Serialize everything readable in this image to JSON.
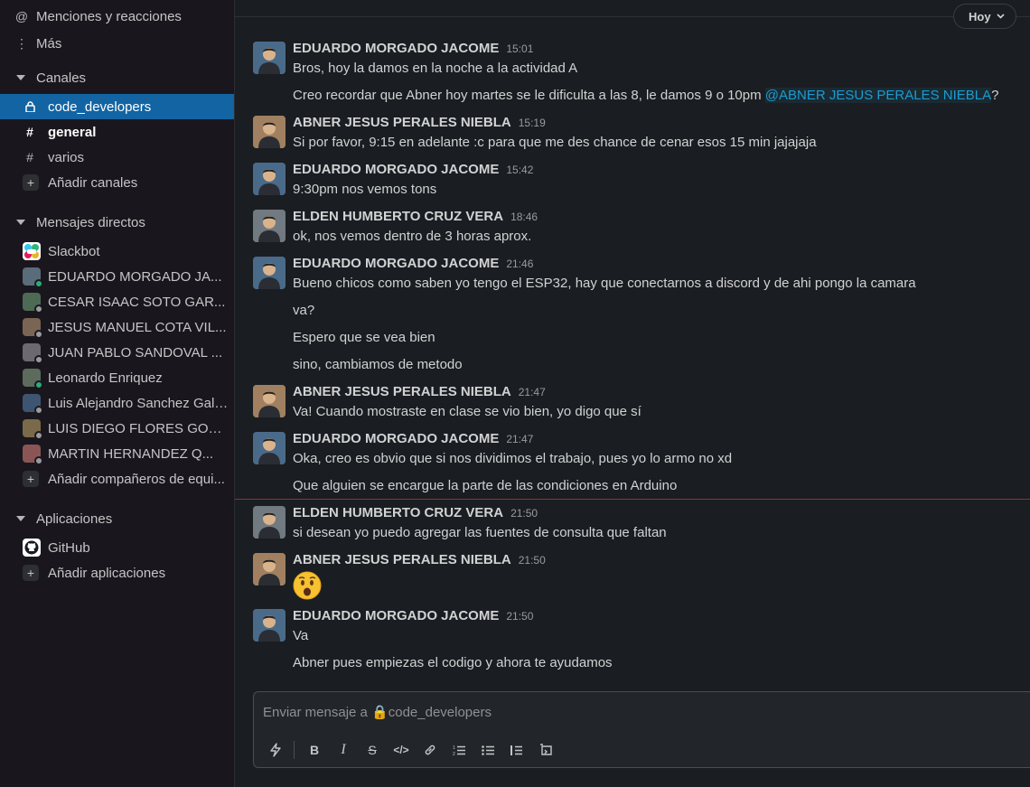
{
  "sidebar": {
    "top_items": [
      {
        "label": "Menciones y reacciones",
        "icon": "at-icon"
      },
      {
        "label": "Más",
        "icon": "more-vertical-icon"
      }
    ],
    "channels_header": "Canales",
    "channels": [
      {
        "label": "code_developers",
        "icon": "lock-icon",
        "active": true
      },
      {
        "label": "general",
        "icon": "hash-icon",
        "bold": true
      },
      {
        "label": "varios",
        "icon": "hash-icon"
      }
    ],
    "add_channels": "Añadir canales",
    "dm_header": "Mensajes directos",
    "dms": [
      {
        "label": "Slackbot",
        "color": "#e8b33a"
      },
      {
        "label": "EDUARDO MORGADO JA...",
        "color": "#5a6b7a",
        "status": "#2bac76"
      },
      {
        "label": "CESAR ISAAC SOTO GAR...",
        "color": "#4d6a55",
        "status": "#9a9b9d"
      },
      {
        "label": "JESUS MANUEL COTA VIL...",
        "color": "#7a6555",
        "status": "#9a9b9d"
      },
      {
        "label": "JUAN PABLO SANDOVAL ...",
        "color": "#6a6a70",
        "status": "#9a9b9d"
      },
      {
        "label": "Leonardo Enriquez",
        "color": "#5c6b5c",
        "status": "#2bac76"
      },
      {
        "label": "Luis Alejandro Sanchez Gall...",
        "color": "#3d5570",
        "status": "#9a9b9d"
      },
      {
        "label": "LUIS DIEGO FLORES GON...",
        "color": "#7a6a4a",
        "status": "#9a9b9d"
      },
      {
        "label": "MARTIN HERNANDEZ Q...",
        "color": "#8a5555",
        "status": "#9a9b9d"
      }
    ],
    "add_teammates": "Añadir compañeros de equi...",
    "apps_header": "Aplicaciones",
    "apps": [
      {
        "label": "GitHub",
        "icon": "github-icon"
      }
    ],
    "add_apps": "Añadir aplicaciones"
  },
  "main": {
    "date_pill": "Hoy",
    "messages": [
      {
        "name": "EDUARDO MORGADO JACOME",
        "time": "15:01",
        "avatar_color": "#4a6a8a",
        "lines": [
          "Bros, hoy la damos en la noche a la actividad A",
          "Creo recordar que Abner hoy martes se le dificulta a las 8, le damos 9 o 10pm "
        ],
        "mention": "@ABNER JESUS PERALES NIEBLA",
        "mention_suffix": "?"
      },
      {
        "name": "ABNER JESUS PERALES NIEBLA",
        "time": "15:19",
        "avatar_color": "#a08060",
        "lines": [
          "Si por favor, 9:15 en adelante :c para que me des chance de cenar esos 15 min jajajaja"
        ]
      },
      {
        "name": "EDUARDO MORGADO JACOME",
        "time": "15:42",
        "avatar_color": "#4a6a8a",
        "lines": [
          "9:30pm nos vemos tons"
        ]
      },
      {
        "name": "ELDEN HUMBERTO CRUZ VERA",
        "time": "18:46",
        "avatar_color": "#707a80",
        "lines": [
          "ok, nos vemos dentro de 3 horas aprox."
        ]
      },
      {
        "name": "EDUARDO MORGADO JACOME",
        "time": "21:46",
        "avatar_color": "#4a6a8a",
        "lines": [
          "Bueno chicos como saben yo tengo el ESP32, hay que conectarnos a discord y de ahi pongo la camara",
          "va?",
          "Espero que se vea bien",
          "sino, cambiamos de metodo"
        ]
      },
      {
        "name": "ABNER JESUS PERALES NIEBLA",
        "time": "21:47",
        "avatar_color": "#a08060",
        "lines": [
          "Va! Cuando mostraste en clase se vio bien, yo digo que sí"
        ]
      },
      {
        "name": "EDUARDO MORGADO JACOME",
        "time": "21:47",
        "avatar_color": "#4a6a8a",
        "lines": [
          "Oka, creo es obvio que si nos dividimos el trabajo, pues yo lo armo no xd",
          "Que alguien se encargue la parte de las condiciones en Arduino"
        ]
      },
      {
        "name": "ELDEN HUMBERTO CRUZ VERA",
        "time": "21:50",
        "avatar_color": "#707a80",
        "lines": [
          "si desean yo puedo agregar las fuentes de consulta que faltan"
        ]
      },
      {
        "name": "ABNER JESUS PERALES NIEBLA",
        "time": "21:50",
        "avatar_color": "#a08060",
        "lines": [],
        "emoji": "hushed-face-emoji"
      },
      {
        "name": "EDUARDO MORGADO JACOME",
        "time": "21:50",
        "avatar_color": "#4a6a8a",
        "lines": [
          "Va",
          "Abner pues empiezas el codigo y ahora te ayudamos"
        ]
      }
    ],
    "composer": {
      "placeholder": "Enviar mensaje a 🔒code_developers",
      "tools": [
        "shortcuts-icon",
        "bold-icon",
        "italic-icon",
        "strikethrough-icon",
        "code-icon",
        "link-icon",
        "ordered-list-icon",
        "bulleted-list-icon",
        "blockquote-icon",
        "code-block-icon"
      ]
    }
  },
  "colors": {
    "accent": "#1264a3",
    "mention": "#1d9bd1",
    "new_line": "#8f3332"
  }
}
